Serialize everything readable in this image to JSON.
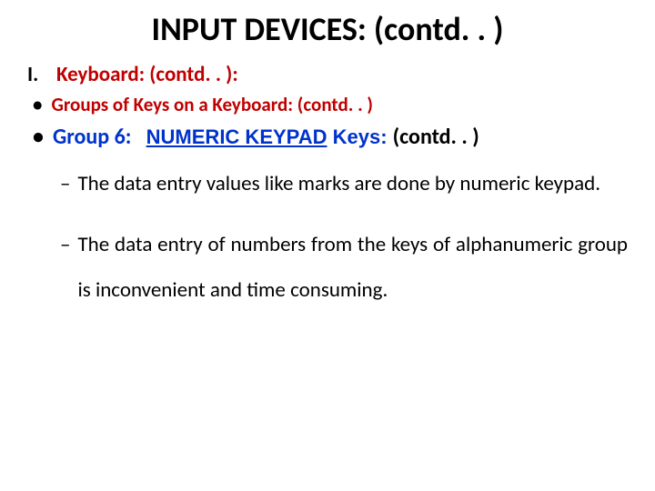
{
  "title": "INPUT DEVICES: (contd. . )",
  "section": {
    "num": "I.",
    "label": "Keyboard: (contd. . ):"
  },
  "bullet1": "Groups of Keys on a Keyboard: (contd. . )",
  "group6": {
    "prefix": "Group 6:",
    "underlined": "NUMERIC KEYPAD",
    "mid": " Keys: ",
    "suffix": "(contd. . )"
  },
  "sub1": "The data entry values like marks are done by numeric keypad.",
  "sub2": "The data entry of numbers from the keys of alphanumeric group is inconvenient and time consuming."
}
